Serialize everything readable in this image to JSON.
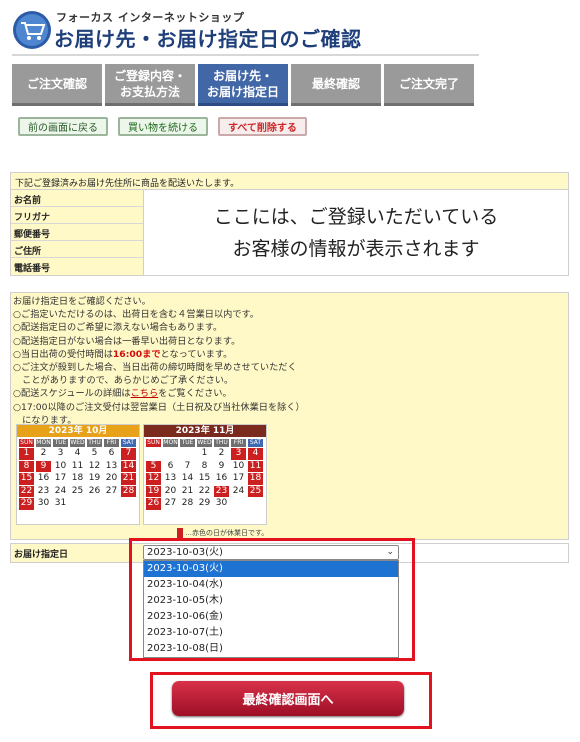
{
  "header": {
    "shop_name": "フォーカス インターネットショップ",
    "page_title": "お届け先・お届け指定日のご確認"
  },
  "steps": [
    {
      "line1": "ご注文確認",
      "line2": "",
      "active": false
    },
    {
      "line1": "ご登録内容・",
      "line2": "お支払方法",
      "active": false
    },
    {
      "line1": "お届け先・",
      "line2": "お届け指定日",
      "active": true
    },
    {
      "line1": "最終確認",
      "line2": "",
      "active": false
    },
    {
      "line1": "ご注文完了",
      "line2": "",
      "active": false
    }
  ],
  "actions": {
    "back": "前の画面に戻る",
    "continue": "買い物を続ける",
    "delete_all": "すべて削除する"
  },
  "customer_info": {
    "header": "下記ご登録済みお届け先住所に商品を配送いたします。",
    "labels": [
      "お名前",
      "フリガナ",
      "郵便番号",
      "ご住所",
      "電話番号"
    ],
    "message_line1": "ここには、ご登録いただいている",
    "message_line2": "お客様の情報が表示されます"
  },
  "delivery_notes": {
    "l1": "お届け指定日をご確認ください。",
    "l2": "○ご指定いただけるのは、出荷日を含む４営業日以内です。",
    "l3": "○配送指定日のご希望に添えない場合もあります。",
    "l4": "○配送指定日がない場合は一番早い出荷日となります。",
    "l5_pre": "○当日出荷の受付時間は",
    "l5_red": "16:00まで",
    "l5_post": "となっています。",
    "l6": "○ご注文が殺到した場合、当日出荷の締切時間を早めさせていただく",
    "l7": "　ことがありますので、あらかじめご了承ください。",
    "l8_pre": "○配送スケジュールの詳細は",
    "l8_link": "こちら",
    "l8_post": "をご覧ください。",
    "l9": "○17:00以降のご注文受付は翌営業日（土日祝及び当社休業日を除く）",
    "l10": "　になります。"
  },
  "calendars": [
    {
      "title": "2023年 10月",
      "title_color": "#e8a21a",
      "lead_blanks": 0,
      "days": 31,
      "holidays": [
        1,
        7,
        8,
        9,
        14,
        15,
        21,
        22,
        28,
        29
      ]
    },
    {
      "title": "2023年 11月",
      "title_color": "#7a2b1d",
      "lead_blanks": 3,
      "days": 30,
      "holidays": [
        3,
        4,
        5,
        11,
        12,
        18,
        19,
        23,
        25,
        26
      ]
    }
  ],
  "weekdays": [
    "SUN",
    "MON",
    "TUE",
    "WED",
    "THU",
    "FRI",
    "SAT"
  ],
  "legend": "…赤色の日が休業日です。",
  "delivery_date": {
    "label": "お届け指定日",
    "selected": "2023-10-03(火)",
    "options": [
      "2023-10-03(火)",
      "2023-10-04(水)",
      "2023-10-05(木)",
      "2023-10-06(金)",
      "2023-10-07(土)",
      "2023-10-08(日)"
    ]
  },
  "confirm_button": "最終確認画面へ",
  "colors": {
    "brand_blue": "#1f3f7a",
    "step_active": "#4267a6",
    "highlight_red": "#e2131f",
    "info_bg": "#fff9c7"
  }
}
